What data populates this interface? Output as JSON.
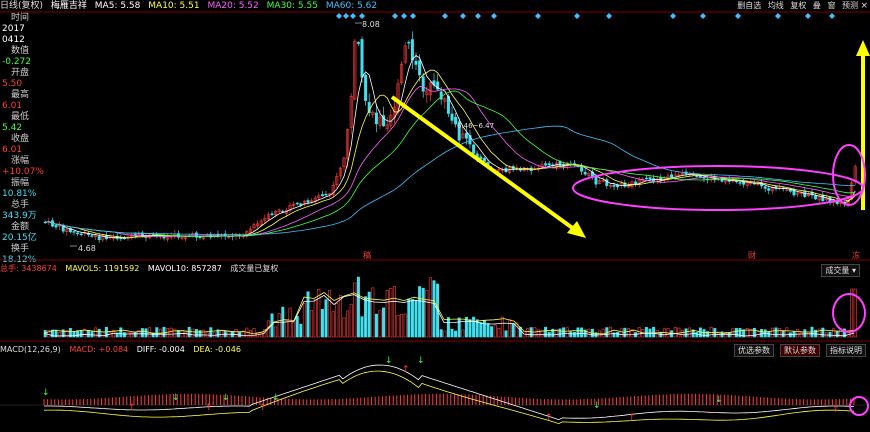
{
  "header": {
    "period": "日线(复权)",
    "stock": "梅雁吉祥",
    "ma": [
      {
        "label": "MA5: 5.58",
        "color": "#ffffff"
      },
      {
        "label": "MA10: 5.51",
        "color": "#ffff40"
      },
      {
        "label": "MA20: 5.52",
        "color": "#ff60ff"
      },
      {
        "label": "MA30: 5.55",
        "color": "#40ff40"
      },
      {
        "label": "MA60: 5.62",
        "color": "#40c0ff"
      }
    ],
    "tools": [
      "删自选",
      "均线",
      "复权",
      "叠",
      "窗",
      "预测"
    ]
  },
  "sidebar": {
    "time_label": "时间",
    "year": "2017",
    "date": "0412",
    "change_label": "数值",
    "change_value": "-0.272",
    "open_label": "开盘",
    "open_value": "5.50",
    "high_label": "最高",
    "high_value": "6.01",
    "low_label": "最低",
    "low_value": "5.42",
    "close_label": "收盘",
    "close_value": "6.01",
    "pct_label": "涨幅",
    "pct_value": "+10.07%",
    "amp_label": "振幅",
    "amp_value": "10.81%",
    "vol_label": "总手",
    "vol_value": "343.9万",
    "amt_label": "金额",
    "amt_value": "20.15亿",
    "turn_label": "换手",
    "turn_value": "18.12%"
  },
  "price_annotations": {
    "high_mark": "8.08",
    "low_mark": "4.68",
    "mid_mark": "6.46~6.47",
    "event_marks": [
      "稿",
      "财",
      "冻"
    ]
  },
  "volume_panel": {
    "total": "总手: 3438674",
    "mavol5": "MAVOL5: 1191592",
    "mavol10": "MAVOL10: 857287",
    "note": "成交量已复权",
    "dropdown": "成交量"
  },
  "macd_panel": {
    "title": "MACD(12,26,9)",
    "macd": "MACD: +0.084",
    "diff": "DIFF: -0.004",
    "dea": "DEA: -0.046",
    "buttons": [
      "优选参数",
      "默认参数",
      "指标说明"
    ]
  },
  "colors": {
    "up": "#ff3c3c",
    "down": "#40e0f0",
    "ma5": "#ffffff",
    "ma10": "#ffff40",
    "ma20": "#ff60ff",
    "ma30": "#40ff40",
    "ma60": "#40c0ff",
    "arrow": "#ffff00",
    "highlight": "#ff40ff"
  }
}
